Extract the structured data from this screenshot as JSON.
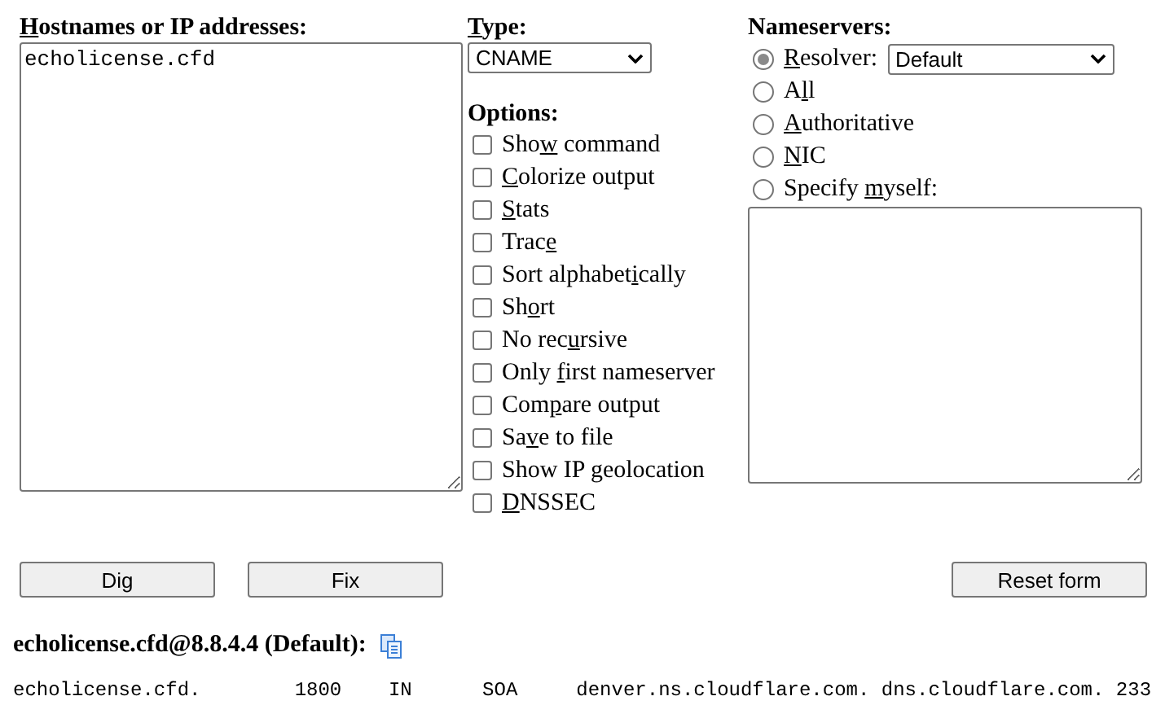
{
  "hostnames": {
    "label": {
      "key": "H",
      "after": "ostnames or IP addresses:"
    },
    "value": "echolicense.cfd"
  },
  "type": {
    "label": {
      "key": "T",
      "after": "ype:"
    },
    "value": "CNAME"
  },
  "options": {
    "title": "Options:",
    "items": [
      {
        "label": {
          "before": "Sho",
          "key": "w",
          "after": " command"
        },
        "checked": false
      },
      {
        "label": {
          "key": "C",
          "after": "olorize output"
        },
        "checked": false
      },
      {
        "label": {
          "key": "S",
          "after": "tats"
        },
        "checked": false
      },
      {
        "label": {
          "before": "Trac",
          "key": "e"
        },
        "checked": false
      },
      {
        "label": {
          "before": "Sort alphabet",
          "key": "i",
          "after": "cally"
        },
        "checked": false
      },
      {
        "label": {
          "before": "Sh",
          "key": "o",
          "after": "rt"
        },
        "checked": false
      },
      {
        "label": {
          "before": "No rec",
          "key": "u",
          "after": "rsive"
        },
        "checked": false
      },
      {
        "label": {
          "before": "Only ",
          "key": "f",
          "after": "irst nameserver"
        },
        "checked": false
      },
      {
        "label": {
          "before": "Com",
          "key": "p",
          "after": "are output"
        },
        "checked": false
      },
      {
        "label": {
          "before": "Sa",
          "key": "v",
          "after": "e to file"
        },
        "checked": false
      },
      {
        "label": {
          "before": "Show IP geolocation"
        },
        "checked": false
      },
      {
        "label": {
          "key": "D",
          "after": "NSSEC"
        },
        "checked": false
      }
    ]
  },
  "nameservers": {
    "title": "Nameservers:",
    "items": [
      {
        "label": {
          "key": "R",
          "after": "esolver:"
        },
        "selected": true,
        "kind": "select",
        "value": "Default"
      },
      {
        "label": {
          "before": "A",
          "key": "l",
          "after": "l"
        },
        "selected": false,
        "kind": "plain"
      },
      {
        "label": {
          "key": "A",
          "after": "uthoritative"
        },
        "selected": false,
        "kind": "plain"
      },
      {
        "label": {
          "key": "N",
          "after": "IC"
        },
        "selected": false,
        "kind": "plain"
      },
      {
        "label": {
          "before": "Specify ",
          "key": "m",
          "after": "yself:"
        },
        "selected": false,
        "kind": "plain"
      }
    ]
  },
  "buttons": {
    "left": [
      "Dig",
      "Fix"
    ],
    "right": "Reset form"
  },
  "result": {
    "heading": "echolicense.cfd@8.8.4.4 (Default):",
    "lines": [
      "echolicense.cfd.\t1800\tIN\tSOA\tdenver.ns.cloudflare.com. dns.cloudflare.com. 233"
    ]
  }
}
